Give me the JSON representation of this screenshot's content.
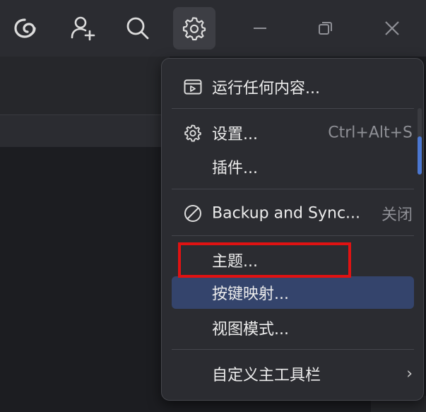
{
  "titlebar": {
    "buttons": [
      {
        "icon": "tabby-logo-icon"
      },
      {
        "icon": "add-profile-icon"
      },
      {
        "icon": "search-icon"
      },
      {
        "icon": "settings-gear-icon",
        "active": true
      },
      {
        "icon": "minimize-icon"
      },
      {
        "icon": "restore-icon"
      },
      {
        "icon": "close-icon"
      }
    ]
  },
  "menu": {
    "items": [
      {
        "label": "运行任何内容...",
        "icon": "run-panel-icon"
      },
      {
        "label": "设置...",
        "icon": "gear-icon",
        "shortcut": "Ctrl+Alt+S"
      },
      {
        "label": "插件..."
      },
      {
        "label": "Backup and Sync...",
        "icon": "disabled-circle-icon",
        "shortcut": "关闭"
      },
      {
        "label": "主题..."
      },
      {
        "label": "按键映射...",
        "highlighted": true
      },
      {
        "label": "视图模式..."
      },
      {
        "label": "自定义主工具栏",
        "submenu": true
      }
    ]
  },
  "colors": {
    "accent": "#4b77d1",
    "highlight": "#34446c",
    "annotation": "#e01212"
  }
}
